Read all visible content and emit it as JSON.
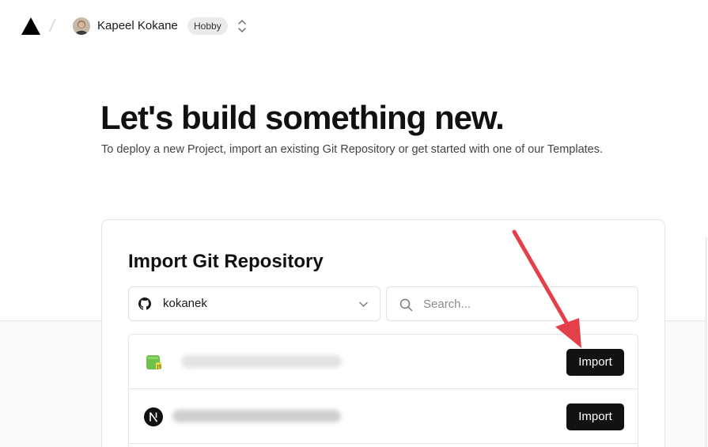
{
  "header": {
    "user_name": "Kapeel Kokane",
    "plan_badge": "Hobby"
  },
  "hero": {
    "title": "Let's build something new.",
    "subtitle": "To deploy a new Project, import an existing Git Repository or get started with one of our Templates."
  },
  "import_card": {
    "title": "Import Git Repository",
    "git_provider_icon": "github-icon",
    "owner_value": "kokanek",
    "search_placeholder": "Search...",
    "repos": [
      {
        "icon": "nodejs-icon",
        "import_label": "Import"
      },
      {
        "icon": "nextjs-icon",
        "import_label": "Import"
      }
    ]
  },
  "annotation": {
    "arrow_color": "#e5404a"
  },
  "colors": {
    "button_bg": "#121212",
    "border": "#e3e3e3",
    "lower_band": "#fafafa"
  }
}
